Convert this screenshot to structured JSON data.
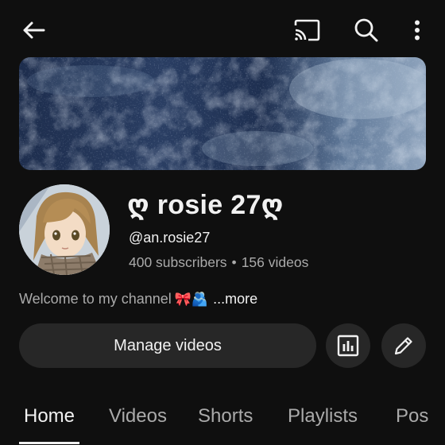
{
  "channel": {
    "name": "ღ rosie 27ღ",
    "handle": "@an.rosie27",
    "subscribers": "400 subscribers",
    "separator": "•",
    "videos": "156 videos",
    "description": "Welcome to my channel",
    "description_emoji": "🎀🫂",
    "more_label": "...more"
  },
  "actions": {
    "manage_videos": "Manage videos"
  },
  "tabs": [
    {
      "label": "Home",
      "active": true
    },
    {
      "label": "Videos",
      "active": false
    },
    {
      "label": "Shorts",
      "active": false
    },
    {
      "label": "Playlists",
      "active": false
    },
    {
      "label": "Pos",
      "active": false
    }
  ],
  "icons": {
    "back": "arrow-left",
    "cast": "cast",
    "search": "search",
    "more": "more-vertical",
    "analytics": "bar-chart",
    "edit": "pencil"
  },
  "colors": {
    "background": "#0f0f0f",
    "button_bg": "#272727",
    "text_primary": "#f1f1f1",
    "text_secondary": "#aaaaaa"
  }
}
